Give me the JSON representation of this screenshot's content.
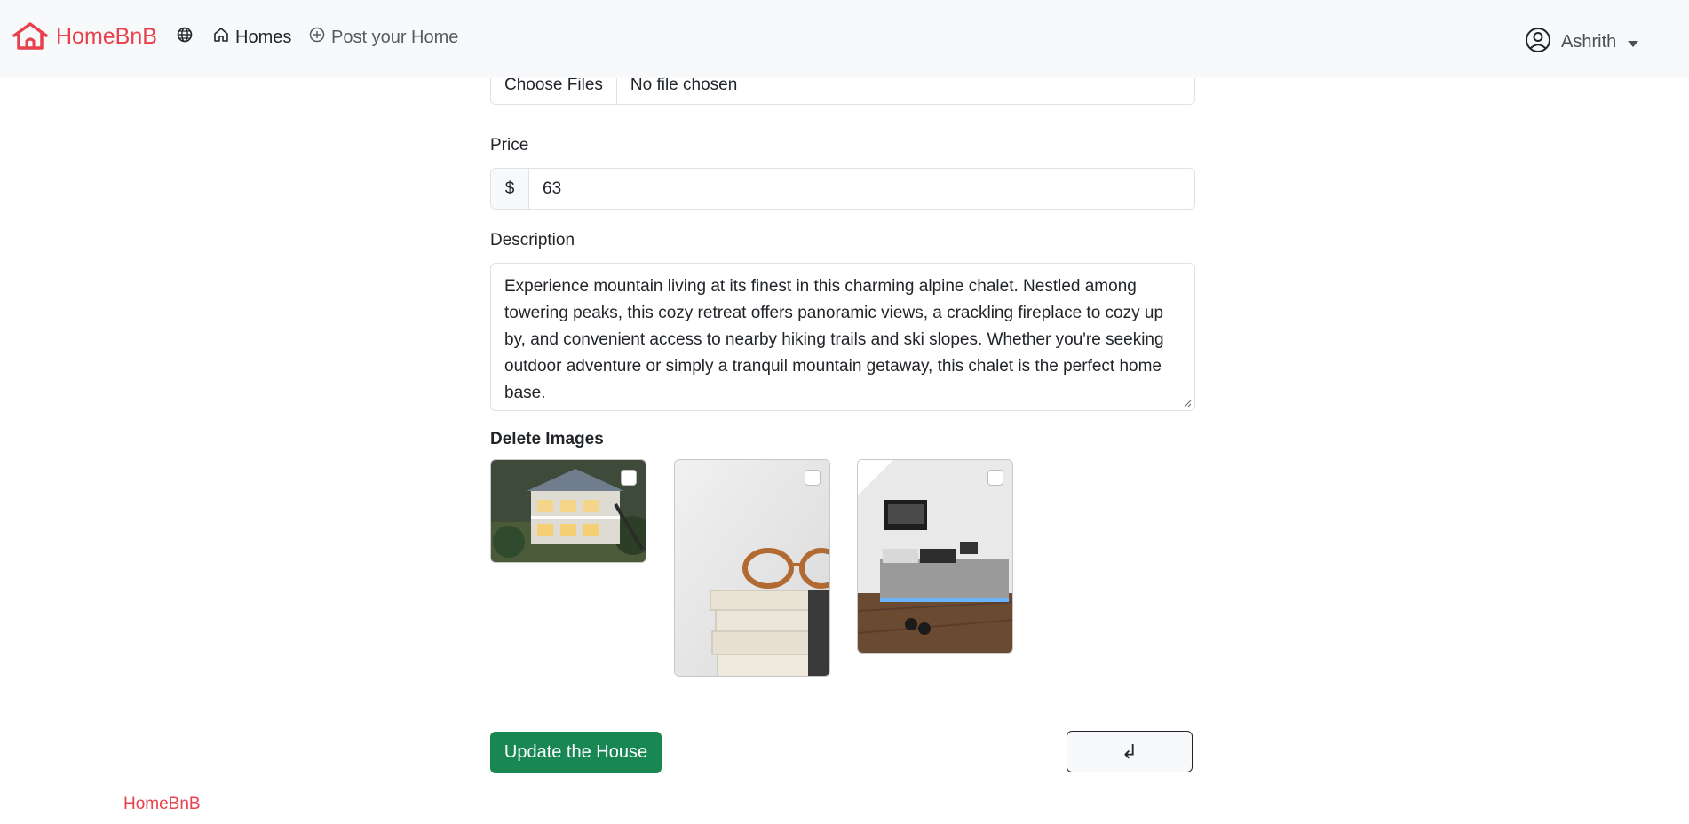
{
  "brand": {
    "name": "HomeBnB",
    "color": "#e8414c",
    "logo_icon": "house-icon"
  },
  "nav": {
    "globe_icon": "globe-icon",
    "homes_label": "Homes",
    "post_label": "Post your Home"
  },
  "user": {
    "name": "Ashrith",
    "icon": "user-circle-icon"
  },
  "form": {
    "file_button": "Choose Files",
    "file_status": "No file chosen",
    "price_label": "Price",
    "price_prefix": "$",
    "price_value": "63",
    "description_label": "Description",
    "description_value": "Experience mountain living at its finest in this charming alpine chalet. Nestled among towering peaks, this cozy retreat offers panoramic views, a crackling fireplace to cozy up by, and convenient access to nearby hiking trails and ski slopes. Whether you're seeking outdoor adventure or simply a tranquil mountain getaway, this chalet is the perfect home base.",
    "delete_images_label": "Delete Images",
    "images": [
      {
        "subject": "house exterior",
        "checked": false
      },
      {
        "subject": "glasses on books",
        "checked": false
      },
      {
        "subject": "bedroom interior",
        "checked": false
      }
    ],
    "submit_label": "Update the House",
    "back_symbol": "↲"
  },
  "footer": {
    "brand": "HomeBnB"
  },
  "colors": {
    "accent": "#e8414c",
    "success": "#198754",
    "navbar_bg": "#f8f9fa"
  }
}
